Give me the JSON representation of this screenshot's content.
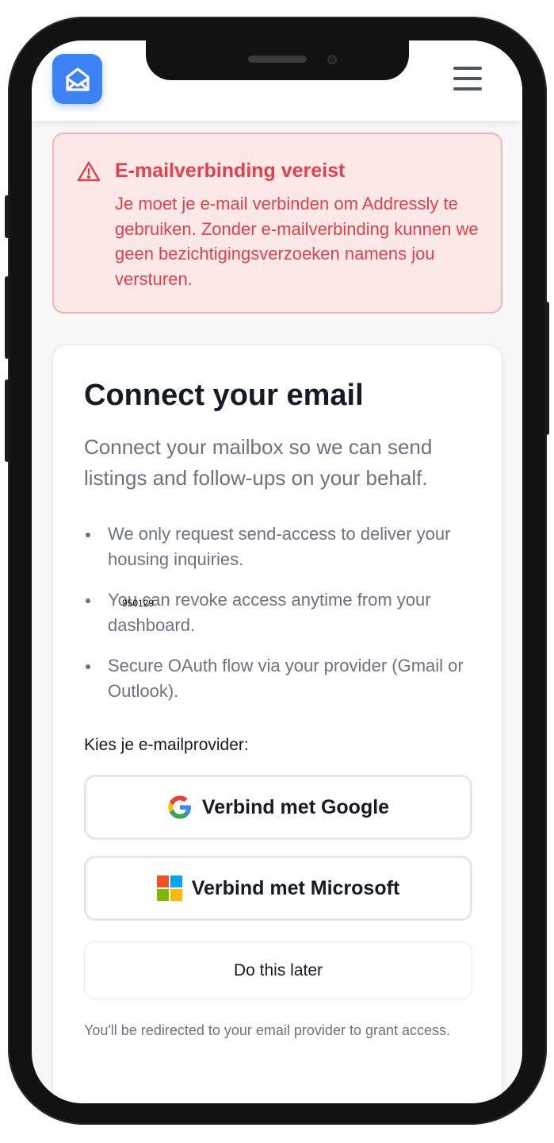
{
  "header": {
    "logo_icon": "house-mail-icon",
    "menu_icon": "hamburger-menu-icon"
  },
  "alert": {
    "icon": "warning-triangle-icon",
    "title": "E-mailverbinding vereist",
    "body": "Je moet je e-mail verbinden om Addressly te gebruiken. Zonder e-mailverbinding kunnen we geen bezichtigingsverzoeken namens jou versturen.",
    "color": "#e0414a"
  },
  "card": {
    "title": "Connect your email",
    "subtitle": "Connect your mailbox so we can send listings and follow-ups on your behalf.",
    "bullets": [
      "We only request send-access to deliver your housing inquiries.",
      "You can revoke access anytime from your dashboard.",
      "Secure OAuth flow via your provider (Gmail or Outlook)."
    ],
    "overlay_code": "950129",
    "choose_label": "Kies je e-mailprovider:",
    "google_button": "Verbind met Google",
    "microsoft_button": "Verbind met Microsoft",
    "later_button": "Do this later",
    "note": "You'll be redirected to your email provider to grant access."
  },
  "colors": {
    "brand": "#3b82f6",
    "text_dark": "#141a26",
    "text_muted": "#6b7280"
  }
}
